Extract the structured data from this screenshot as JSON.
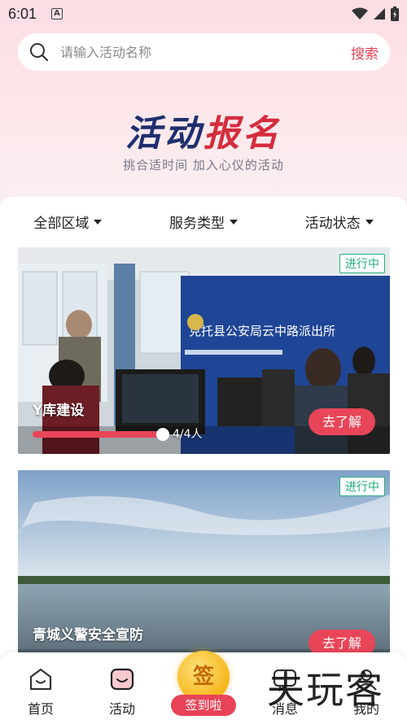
{
  "status_bar": {
    "time": "6:01",
    "notif_icon": "A"
  },
  "search": {
    "placeholder": "请输入活动名称",
    "button_label": "搜索"
  },
  "hero": {
    "title_part1": "活动",
    "title_part2": "报名",
    "subtitle": "挑合适时间 加入心仪的活动"
  },
  "filters": [
    {
      "label": "全部区域"
    },
    {
      "label": "服务类型"
    },
    {
      "label": "活动状态"
    }
  ],
  "activities": [
    {
      "status": "进行中",
      "title": "Y库建设",
      "sign_text": "克托县公安局云中路派出所",
      "progress_text": "4/4人",
      "progress": 1.0,
      "action_label": "去了解"
    },
    {
      "status": "进行中",
      "title": "青城义警安全宣防",
      "action_label": "去了解"
    }
  ],
  "tabbar": {
    "home": "首页",
    "activity": "活动",
    "checkin_icon": "签",
    "checkin_label": "签到啦",
    "messages": "消息",
    "me": "我的"
  },
  "watermark": "夫玩客",
  "colors": {
    "accent": "#e84356",
    "badge": "#23b07a",
    "title_navy": "#1e2f6e",
    "title_red": "#d42c3c"
  }
}
